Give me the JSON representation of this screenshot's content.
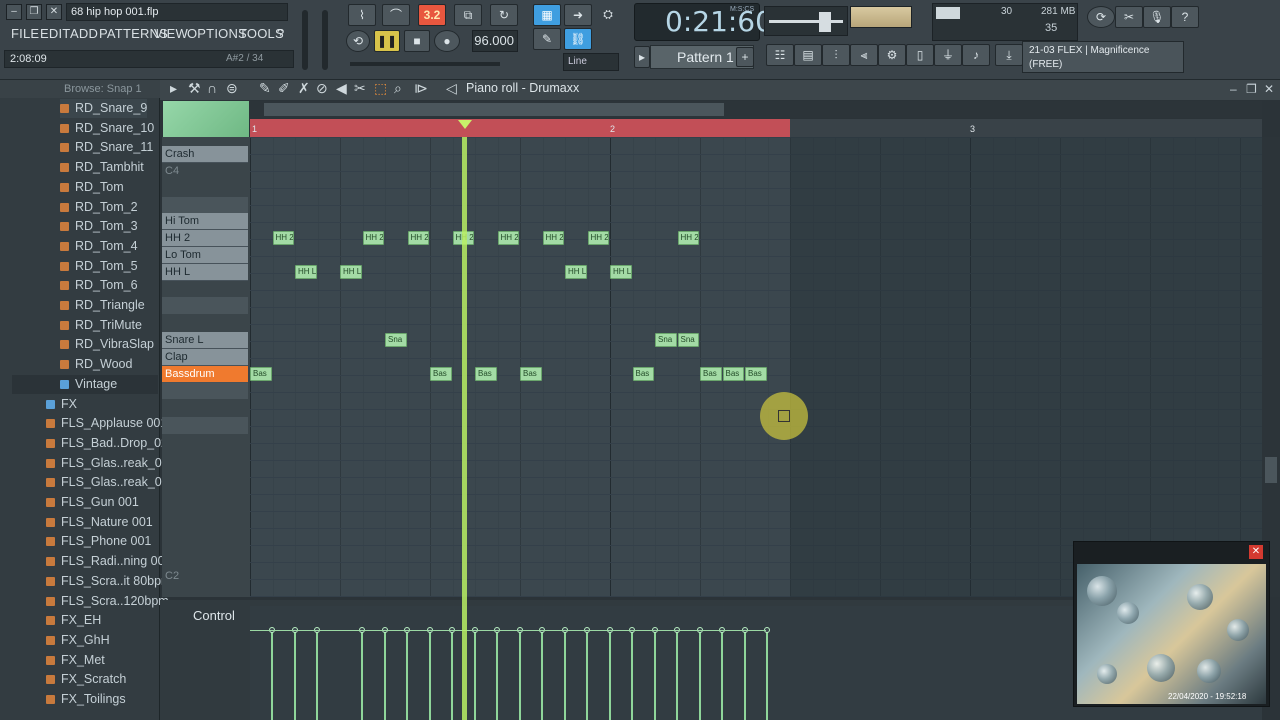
{
  "window": {
    "title": "68 hip hop 001.flp"
  },
  "menu": [
    "FILE",
    "EDIT",
    "ADD",
    "PATTERNS",
    "VIEW",
    "OPTIONS",
    "TOOLS",
    "?"
  ],
  "hint": {
    "text": "2:08:09",
    "note": "A#2 / 34"
  },
  "transport": {
    "time": "0:21:60",
    "time_mode": "M:S:CS",
    "tempo": "96.000",
    "pattern": "Pattern 1",
    "snap": "Line",
    "step_counter": "3.2"
  },
  "stats": {
    "memory": "281 MB",
    "cpu_top": "30",
    "cpu_bottom": "35"
  },
  "plugin": {
    "line1": "21-03 FLEX | Magnificence",
    "line2": "(FREE)"
  },
  "browser": {
    "header": "Browse: Snap 1",
    "items": [
      {
        "label": "RD_Snare_9",
        "type": "file",
        "selected": true
      },
      {
        "label": "RD_Snare_10",
        "type": "file"
      },
      {
        "label": "RD_Snare_11",
        "type": "file"
      },
      {
        "label": "RD_Tambhit",
        "type": "file"
      },
      {
        "label": "RD_Tom",
        "type": "file"
      },
      {
        "label": "RD_Tom_2",
        "type": "file"
      },
      {
        "label": "RD_Tom_3",
        "type": "file"
      },
      {
        "label": "RD_Tom_4",
        "type": "file"
      },
      {
        "label": "RD_Tom_5",
        "type": "file"
      },
      {
        "label": "RD_Tom_6",
        "type": "file"
      },
      {
        "label": "RD_Triangle",
        "type": "file"
      },
      {
        "label": "RD_TriMute",
        "type": "file"
      },
      {
        "label": "RD_VibraSlap",
        "type": "file"
      },
      {
        "label": "RD_Wood",
        "type": "file"
      },
      {
        "label": "Vintage",
        "type": "folder"
      },
      {
        "label": "FX",
        "type": "folder"
      },
      {
        "label": "FLS_Applause 001",
        "type": "file"
      },
      {
        "label": "FLS_Bad..Drop_02",
        "type": "file"
      },
      {
        "label": "FLS_Glas..reak_01",
        "type": "file"
      },
      {
        "label": "FLS_Glas..reak_02",
        "type": "file"
      },
      {
        "label": "FLS_Gun 001",
        "type": "file"
      },
      {
        "label": "FLS_Nature 001",
        "type": "file"
      },
      {
        "label": "FLS_Phone 001",
        "type": "file"
      },
      {
        "label": "FLS_Radi..ning 001",
        "type": "file"
      },
      {
        "label": "FLS_Scra..it 80bpm",
        "type": "file"
      },
      {
        "label": "FLS_Scra..120bpm",
        "type": "file"
      },
      {
        "label": "FX_EH",
        "type": "file"
      },
      {
        "label": "FX_GhH",
        "type": "file"
      },
      {
        "label": "FX_Met",
        "type": "file"
      },
      {
        "label": "FX_Scratch",
        "type": "file"
      },
      {
        "label": "FX_Toilings",
        "type": "file"
      }
    ]
  },
  "piano_roll": {
    "title": "Piano roll - Drumaxx",
    "bars": [
      "1",
      "2",
      "3"
    ],
    "keys": [
      {
        "label": "Crash",
        "type": "white"
      },
      {
        "label": "C4",
        "type": "c"
      },
      {
        "label": "Hi Tom",
        "type": "white"
      },
      {
        "label": "HH 2",
        "type": "white"
      },
      {
        "label": "Lo Tom",
        "type": "white"
      },
      {
        "label": "HH L",
        "type": "white"
      },
      {
        "label": "Snare L",
        "type": "white"
      },
      {
        "label": "Clap",
        "type": "white"
      },
      {
        "label": "Bassdrum",
        "type": "selected"
      },
      {
        "label": "C2",
        "type": "c"
      }
    ],
    "notes": [
      {
        "row": "HH 2",
        "label": "HH 2",
        "step": 1
      },
      {
        "row": "HH 2",
        "label": "HH 2",
        "step": 5
      },
      {
        "row": "HH 2",
        "label": "HH 2",
        "step": 7
      },
      {
        "row": "HH 2",
        "label": "HH 2",
        "step": 9
      },
      {
        "row": "HH 2",
        "label": "HH 2",
        "step": 11
      },
      {
        "row": "HH 2",
        "label": "HH 2",
        "step": 13
      },
      {
        "row": "HH 2",
        "label": "HH 2",
        "step": 15
      },
      {
        "row": "HH 2",
        "label": "HH 2",
        "step": 19
      },
      {
        "row": "HH L",
        "label": "HH L",
        "step": 2
      },
      {
        "row": "HH L",
        "label": "HH L",
        "step": 4
      },
      {
        "row": "HH L",
        "label": "HH L",
        "step": 14
      },
      {
        "row": "HH L",
        "label": "HH L",
        "step": 16
      },
      {
        "row": "Snare L",
        "label": "Sna",
        "step": 6
      },
      {
        "row": "Snare L",
        "label": "Sna",
        "step": 18
      },
      {
        "row": "Snare L",
        "label": "Sna",
        "step": 19
      },
      {
        "row": "Bassdrum",
        "label": "Bas",
        "step": 0
      },
      {
        "row": "Bassdrum",
        "label": "Bas",
        "step": 8
      },
      {
        "row": "Bassdrum",
        "label": "Bas",
        "step": 10
      },
      {
        "row": "Bassdrum",
        "label": "Bas",
        "step": 12
      },
      {
        "row": "Bassdrum",
        "label": "Bas",
        "step": 17
      },
      {
        "row": "Bassdrum",
        "label": "Bas",
        "step": 20
      },
      {
        "row": "Bassdrum",
        "label": "Bas",
        "step": 21
      },
      {
        "row": "Bassdrum",
        "label": "Bas",
        "step": 22
      }
    ],
    "control_label": "Control"
  },
  "webcam": {
    "timestamp": "22/04/2020 - 19:52:18",
    "close": "✕"
  },
  "colors": {
    "accent": "#3f9ee0",
    "loop": "#c24f57",
    "note": "#a3dba5",
    "playhead": "#b8ee64",
    "selected_key": "#f07a2e"
  }
}
